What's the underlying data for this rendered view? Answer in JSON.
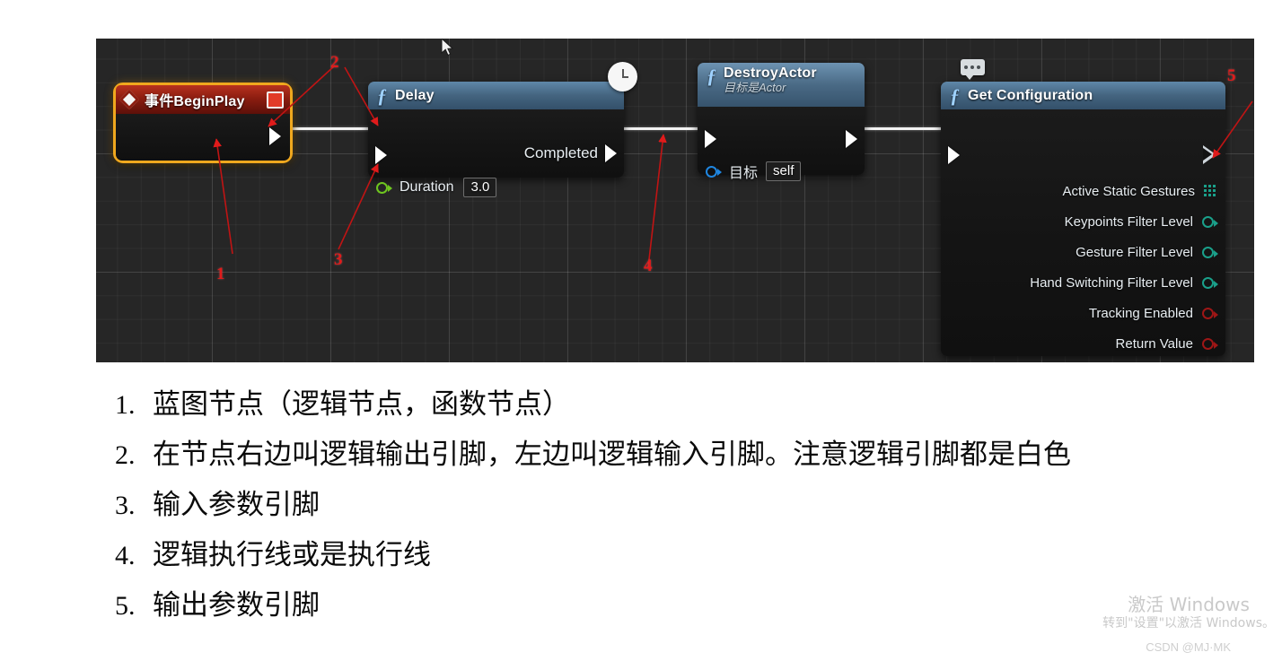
{
  "canvas": {
    "cursor_icon": "mouse-pointer-icon",
    "nodes": [
      {
        "id": "begin-play",
        "type": "event",
        "title": "事件BeginPlay",
        "header_icon": "event-diamond-icon",
        "action_icon": "red-square-icon",
        "selected": true,
        "output_exec": ""
      },
      {
        "id": "delay",
        "type": "function",
        "title": "Delay",
        "header_icon": "function-f-icon",
        "badge_icon": "clock-icon",
        "output_exec_label": "Completed",
        "inputs": [
          {
            "label": "Duration",
            "pin": "float-pin",
            "value": "3.0"
          }
        ]
      },
      {
        "id": "destroy-actor",
        "type": "function",
        "title": "DestroyActor",
        "subtitle": "目标是Actor",
        "header_icon": "function-f-icon",
        "inputs": [
          {
            "label": "目标",
            "pin": "object-pin",
            "value": "self"
          }
        ]
      },
      {
        "id": "get-configuration",
        "type": "function",
        "title": "Get Configuration",
        "header_icon": "function-f-icon",
        "badge_icon": "comment-bubble-icon",
        "outputs": [
          {
            "label": "Active Static Gestures",
            "pin": "array-pin",
            "color": "#1aa08a"
          },
          {
            "label": "Keypoints Filter Level",
            "pin": "enum-pin",
            "color": "#1aa08a"
          },
          {
            "label": "Gesture Filter Level",
            "pin": "enum-pin",
            "color": "#1aa08a"
          },
          {
            "label": "Hand Switching Filter Level",
            "pin": "enum-pin",
            "color": "#1aa08a"
          },
          {
            "label": "Tracking Enabled",
            "pin": "bool-pin",
            "color": "#9e1616"
          },
          {
            "label": "Return Value",
            "pin": "bool-pin",
            "color": "#9e1616"
          }
        ]
      }
    ],
    "annotations": [
      {
        "num": "1",
        "target": "node-body"
      },
      {
        "num": "2",
        "target": "exec-pins"
      },
      {
        "num": "3",
        "target": "input-parameter-pin"
      },
      {
        "num": "4",
        "target": "exec-wire"
      },
      {
        "num": "5",
        "target": "output-parameter-pin"
      }
    ]
  },
  "list": {
    "items": [
      {
        "num": "1.",
        "text": "蓝图节点（逻辑节点，函数节点）"
      },
      {
        "num": "2.",
        "text": "在节点右边叫逻辑输出引脚，左边叫逻辑输入引脚。注意逻辑引脚都是白色"
      },
      {
        "num": "3.",
        "text": "输入参数引脚"
      },
      {
        "num": "4.",
        "text": "逻辑执行线或是执行线"
      },
      {
        "num": "5.",
        "text": "输出参数引脚"
      }
    ]
  },
  "watermarks": {
    "windows_line1": "激活 Windows",
    "windows_line2": "转到\"设置\"以激活 Windows。",
    "csdn": "CSDN @MJ·MK"
  },
  "colors": {
    "canvas_bg": "#262626",
    "event_header": "#8b1c10",
    "function_header": "#3f6b8e",
    "selection": "#f0a81e",
    "exec_wire": "#f2f2f2",
    "annotation_red": "#e01b1b"
  }
}
